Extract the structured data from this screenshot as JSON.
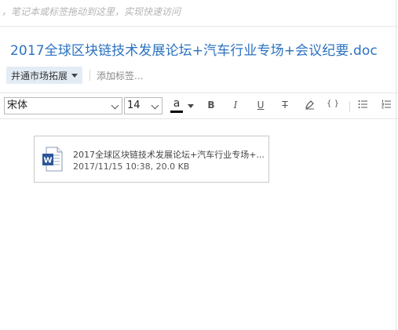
{
  "drop_hint": "，笔记本或标签拖动到这里，实现快速访问",
  "note": {
    "title": "2017全球区块链技术发展论坛+汽车行业专场+会议纪要.doc"
  },
  "tags": {
    "notebook_label": "井通市场拓展",
    "add_tag_placeholder": "添加标签..."
  },
  "toolbar": {
    "font_family": "宋体",
    "font_size": "14",
    "font_color_label": "a",
    "font_color": "#000000",
    "bold_label": "B",
    "italic_label": "I",
    "underline_label": "U",
    "strike_label": "T",
    "code_label": "{ }"
  },
  "attachment": {
    "name": "2017全球区块链技术发展论坛+汽车行业专场+...",
    "meta": "2017/11/15 10:38, 20.0 KB",
    "icon": "word-doc-icon",
    "icon_color": "#2b5797"
  }
}
